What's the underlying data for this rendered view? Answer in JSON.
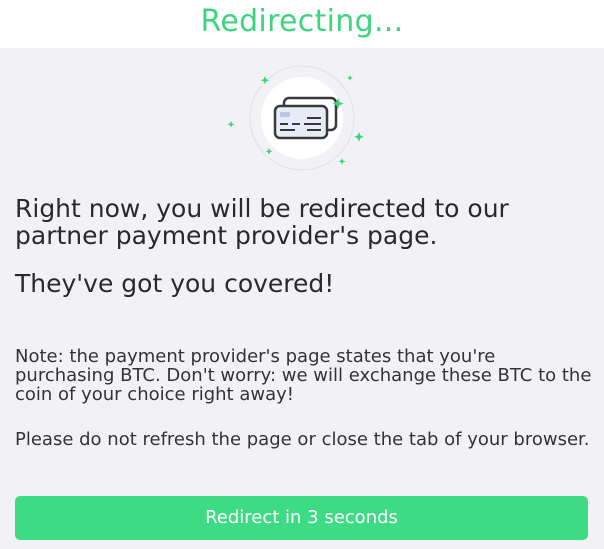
{
  "header": {
    "title": "Redirecting..."
  },
  "illustration": {
    "icon": "credit-card-icon",
    "accent_color": "#3ed47f"
  },
  "message": {
    "lead": "Right now, you will be redirected to our partner payment provider's page.",
    "reassurance": "They've got you covered!",
    "note": "Note: the payment provider's page states that you're purchasing BTC. Don't worry: we will exchange these BTC to the coin of your choice right away!",
    "warning": "Please do not refresh the page or close the tab of your browser."
  },
  "cta": {
    "label": "Redirect in 3 seconds",
    "color": "#3ddc84"
  }
}
